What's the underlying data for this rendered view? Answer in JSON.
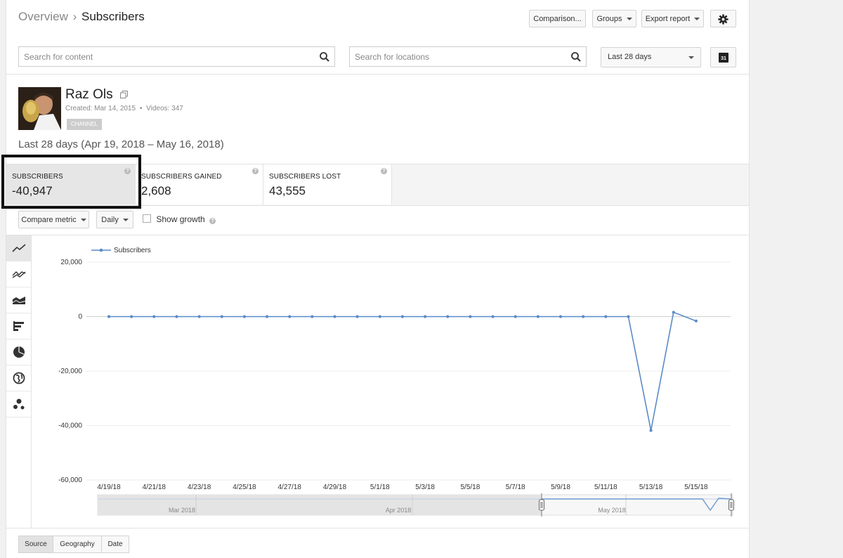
{
  "breadcrumb": {
    "parent": "Overview",
    "separator": "›",
    "current": "Subscribers"
  },
  "toolbar": {
    "comparison": "Comparison...",
    "groups": "Groups",
    "export": "Export report"
  },
  "search": {
    "content_placeholder": "Search for content",
    "locations_placeholder": "Search for locations"
  },
  "date_range": {
    "selected": "Last 28 days",
    "calendar_day": "31"
  },
  "channel": {
    "name": "Raz Ols",
    "created": "Created: Mar 14, 2015",
    "bullet": "•",
    "videos": "Videos: 347",
    "badge": "CHANNEL"
  },
  "period_text": "Last 28 days (Apr 19, 2018 – May 16, 2018)",
  "metrics": [
    {
      "label": "SUBSCRIBERS",
      "value": "-40,947"
    },
    {
      "label": "SUBSCRIBERS GAINED",
      "value": "2,608"
    },
    {
      "label": "SUBSCRIBERS LOST",
      "value": "43,555"
    }
  ],
  "controls": {
    "compare_metric": "Compare metric",
    "interval": "Daily",
    "show_growth": "Show growth"
  },
  "side_icons": [
    "line-chart-icon",
    "multi-line-icon",
    "stacked-area-icon",
    "bar-chart-icon",
    "pie-chart-icon",
    "globe-icon",
    "bubble-chart-icon"
  ],
  "chart_data": {
    "type": "line",
    "series": [
      {
        "name": "Subscribers",
        "color": "#5b8ac7",
        "values": [
          0,
          0,
          0,
          0,
          0,
          0,
          0,
          0,
          0,
          0,
          0,
          0,
          0,
          0,
          0,
          0,
          0,
          0,
          0,
          0,
          0,
          0,
          0,
          0,
          -41800,
          1600,
          -1600
        ]
      }
    ],
    "x": [
      "4/19/18",
      "4/20/18",
      "4/21/18",
      "4/22/18",
      "4/23/18",
      "4/24/18",
      "4/25/18",
      "4/26/18",
      "4/27/18",
      "4/28/18",
      "4/29/18",
      "4/30/18",
      "5/1/18",
      "5/2/18",
      "5/3/18",
      "5/4/18",
      "5/5/18",
      "5/6/18",
      "5/7/18",
      "5/8/18",
      "5/9/18",
      "5/10/18",
      "5/11/18",
      "5/12/18",
      "5/13/18",
      "5/14/18",
      "5/15/18"
    ],
    "x_tick_labels": [
      "4/19/18",
      "4/21/18",
      "4/23/18",
      "4/25/18",
      "4/27/18",
      "4/29/18",
      "5/1/18",
      "5/3/18",
      "5/5/18",
      "5/7/18",
      "5/9/18",
      "5/11/18",
      "5/13/18",
      "5/15/18"
    ],
    "y_ticks": [
      "20,000",
      "0",
      "-20,000",
      "-40,000",
      "-60,000"
    ],
    "ylim": [
      -60000,
      20000
    ],
    "grid": true,
    "legend": "top-left"
  },
  "navigator": {
    "labels": [
      "Mar 2018",
      "Apr 2018",
      "May 2018"
    ]
  },
  "bottom_tabs": [
    "Source",
    "Geography",
    "Date"
  ]
}
